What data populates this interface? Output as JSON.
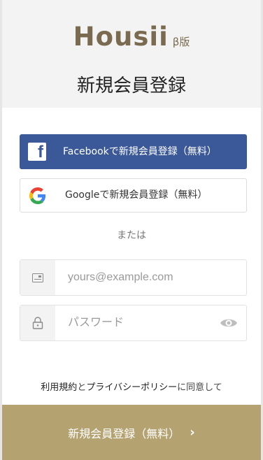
{
  "brand": {
    "name": "Housii",
    "beta": "β版"
  },
  "page": {
    "title": "新規会員登録"
  },
  "social": {
    "facebook_label": "Facebookで新規会員登録（無料）",
    "google_label": "Googleで新規会員登録（無料）"
  },
  "divider": {
    "or_text": "または"
  },
  "form": {
    "email": {
      "placeholder": "yours@example.com",
      "value": "",
      "icon": "email-card-icon"
    },
    "password": {
      "placeholder": "パスワード",
      "value": "",
      "icon": "lock-icon",
      "toggle_icon": "eye-icon"
    }
  },
  "agreement": {
    "terms": "利用規約",
    "and": "と",
    "privacy": "プライバシーポリシー",
    "suffix": "に同意して"
  },
  "submit": {
    "label": "新規会員登録（無料）",
    "icon": "chevron-right-icon"
  },
  "colors": {
    "brand": "#7a6a4f",
    "facebook": "#3b5998",
    "submit": "#b4a271",
    "header_bg": "#f3f3f3"
  }
}
